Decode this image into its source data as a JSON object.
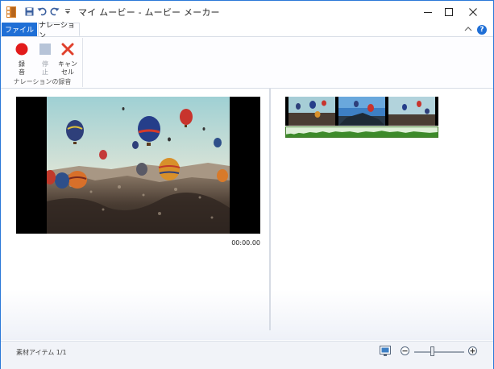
{
  "window": {
    "title": "マイ ムービー - ムービー メーカー",
    "accent": "#1f6fd6"
  },
  "quick_access": [
    "save-icon",
    "undo-icon",
    "redo-icon",
    "customize-qat-icon"
  ],
  "tabs": [
    {
      "label": "ファイル",
      "active": false
    },
    {
      "label": "ナレーション",
      "active": true
    }
  ],
  "ribbon": {
    "group_label": "ナレーションの録音",
    "buttons": [
      {
        "label_line1": "録",
        "label_line2": "音",
        "icon": "record-icon",
        "enabled": true
      },
      {
        "label_line1": "停",
        "label_line2": "止",
        "icon": "stop-icon",
        "enabled": false
      },
      {
        "label_line1": "キャン",
        "label_line2": "セル",
        "icon": "cancel-icon",
        "enabled": true
      }
    ]
  },
  "preview": {
    "timecode": "00:00.00"
  },
  "status": {
    "items_text": "素材アイテム 1/1"
  },
  "zoom": {
    "level": 0.35
  }
}
